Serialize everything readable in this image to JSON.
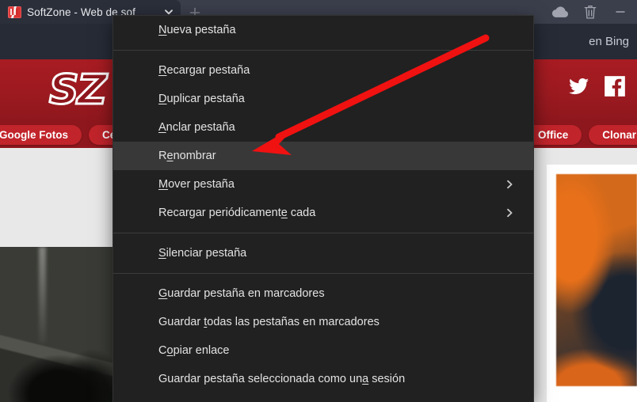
{
  "window": {
    "tab": {
      "title": "SoftZone - Web de sof",
      "favicon_name": "softzone-favicon",
      "chevron_name": "chevron-down-icon"
    },
    "new_tab_label": "+",
    "title_bar_icons": [
      {
        "name": "cloud-sync-icon",
        "label": "Sincronizar"
      },
      {
        "name": "trash-icon",
        "label": "Papelera"
      },
      {
        "name": "minimize-icon",
        "label": "Minimizar"
      }
    ]
  },
  "page": {
    "search_hint": "en Bing",
    "logo_text": "SZ",
    "social": [
      {
        "name": "twitter-icon",
        "label": "Twitter"
      },
      {
        "name": "facebook-icon",
        "label": "Facebook"
      }
    ],
    "bookmarks": [
      {
        "label": "Google Fotos"
      },
      {
        "label": "Ce"
      },
      {
        "label": "Office"
      },
      {
        "label": "Clonar"
      }
    ]
  },
  "context_menu": {
    "groups": [
      {
        "items": [
          {
            "label": "Nueva pestaña",
            "accel": "N",
            "accel_index": 0,
            "name": "menu-item-nueva-pestana",
            "submenu": false,
            "selected": false
          }
        ]
      },
      {
        "items": [
          {
            "label": "Recargar pestaña",
            "accel": "R",
            "accel_index": 0,
            "name": "menu-item-recargar-pestana",
            "submenu": false,
            "selected": false
          },
          {
            "label": "Duplicar pestaña",
            "accel": "D",
            "accel_index": 0,
            "name": "menu-item-duplicar-pestana",
            "submenu": false,
            "selected": false
          },
          {
            "label": "Anclar pestaña",
            "accel": "A",
            "accel_index": 0,
            "name": "menu-item-anclar-pestana",
            "submenu": false,
            "selected": false
          },
          {
            "label": "Renombrar",
            "accel": "e",
            "accel_index": 1,
            "name": "menu-item-renombrar",
            "submenu": false,
            "selected": true
          },
          {
            "label": "Mover pestaña",
            "accel": "M",
            "accel_index": 0,
            "name": "menu-item-mover-pestana",
            "submenu": true,
            "selected": false
          },
          {
            "label": "Recargar periódicamente cada",
            "accel": "c",
            "accel_index": 22,
            "name": "menu-item-recargar-periodicamente",
            "submenu": true,
            "selected": false
          }
        ]
      },
      {
        "items": [
          {
            "label": "Silenciar pestaña",
            "accel": "S",
            "accel_index": 0,
            "name": "menu-item-silenciar-pestana",
            "submenu": false,
            "selected": false
          }
        ]
      },
      {
        "items": [
          {
            "label": "Guardar pestaña en marcadores",
            "accel": "G",
            "accel_index": 0,
            "name": "menu-item-guardar-pestana-marcadores",
            "submenu": false,
            "selected": false
          },
          {
            "label": "Guardar todas las pestañas en marcadores",
            "accel": "t",
            "accel_index": 8,
            "name": "menu-item-guardar-todas-marcadores",
            "submenu": false,
            "selected": false
          },
          {
            "label": "Copiar enlace",
            "accel": "o",
            "accel_index": 1,
            "name": "menu-item-copiar-enlace",
            "submenu": false,
            "selected": false
          },
          {
            "label": "Guardar pestaña seleccionada como una sesión",
            "accel": "u",
            "accel_index": 36,
            "name": "menu-item-guardar-sesion",
            "submenu": false,
            "selected": false
          }
        ]
      }
    ]
  },
  "annotation": {
    "arrow_color": "#f01111",
    "points_at": "Renombrar"
  }
}
